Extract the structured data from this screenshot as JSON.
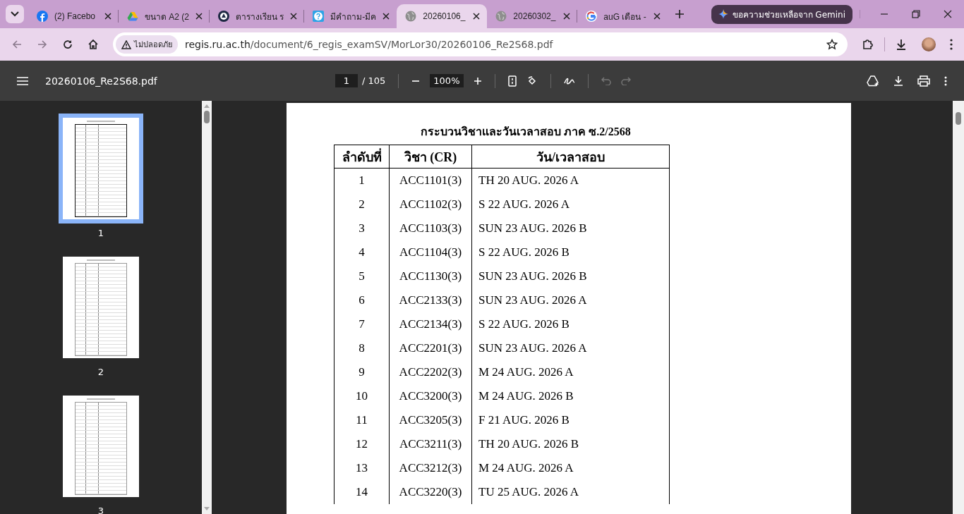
{
  "tabs": [
    {
      "title": "(2) Facebo",
      "selected": false
    },
    {
      "title": "ขนาด A2 (2",
      "selected": false
    },
    {
      "title": "ตารางเรียน ร",
      "selected": false
    },
    {
      "title": "มีคำถาม-มีค",
      "selected": false
    },
    {
      "title": "20260106_",
      "selected": true
    },
    {
      "title": "20260302_",
      "selected": false
    },
    {
      "title": "auG เดือน -",
      "selected": false
    }
  ],
  "gemini_button": "ขอความช่วยเหลือจาก Gemini",
  "address_bar": {
    "security_label": "ไม่ปลอดภัย",
    "host": "regis.ru.ac.th",
    "path": "/document/6_regis_examSV/MorLor30/20260106_Re2S68.pdf"
  },
  "pdf_toolbar": {
    "file_name": "20260106_Re2S68.pdf",
    "page": "1",
    "page_count": "/ 105",
    "zoom": "100%"
  },
  "thumbnails": [
    {
      "label": "1",
      "selected": true
    },
    {
      "label": "2",
      "selected": false
    },
    {
      "label": "3",
      "selected": false
    }
  ],
  "document": {
    "title": "กระบวนวิชาและวันเวลาสอบ ภาค ซ.2/2568",
    "columns": [
      "ลำดับที่",
      "วิชา (CR)",
      "วัน/เวลาสอบ"
    ],
    "rows": [
      [
        "1",
        "ACC1101(3)",
        "TH 20 AUG. 2026 A"
      ],
      [
        "2",
        "ACC1102(3)",
        "S 22 AUG. 2026 A"
      ],
      [
        "3",
        "ACC1103(3)",
        "SUN 23 AUG. 2026 B"
      ],
      [
        "4",
        "ACC1104(3)",
        "S 22 AUG. 2026 B"
      ],
      [
        "5",
        "ACC1130(3)",
        "SUN 23 AUG. 2026 B"
      ],
      [
        "6",
        "ACC2133(3)",
        "SUN 23 AUG. 2026 A"
      ],
      [
        "7",
        "ACC2134(3)",
        "S 22 AUG. 2026 B"
      ],
      [
        "8",
        "ACC2201(3)",
        "SUN 23 AUG. 2026 A"
      ],
      [
        "9",
        "ACC2202(3)",
        "M 24 AUG. 2026 A"
      ],
      [
        "10",
        "ACC3200(3)",
        "M 24 AUG. 2026 B"
      ],
      [
        "11",
        "ACC3205(3)",
        "F 21 AUG. 2026 B"
      ],
      [
        "12",
        "ACC3211(3)",
        "TH 20 AUG. 2026 B"
      ],
      [
        "13",
        "ACC3212(3)",
        "M 24 AUG. 2026 A"
      ],
      [
        "14",
        "ACC3220(3)",
        "TU 25 AUG. 2026 A"
      ]
    ]
  }
}
